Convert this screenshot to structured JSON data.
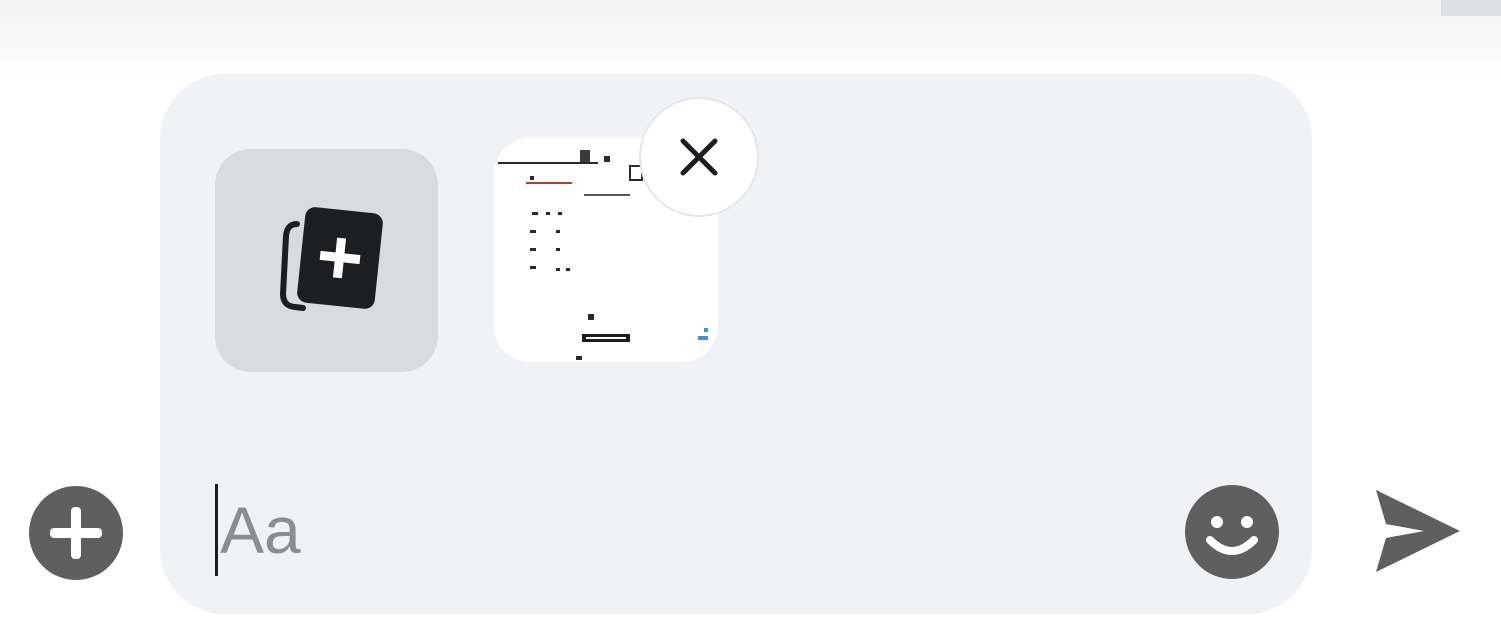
{
  "composer": {
    "placeholder": "Aa",
    "value": ""
  },
  "attachments": {
    "add_icon": "media-add-icon",
    "items": [
      {
        "type": "image",
        "icon": "image-thumbnail",
        "remove_icon": "close-icon"
      }
    ]
  },
  "actions": {
    "more_icon": "plus-circle-icon",
    "emoji_icon": "smiley-icon",
    "send_icon": "send-icon"
  },
  "colors": {
    "background": "#ffffff",
    "composer": "#f0f2f5",
    "tile": "#d8dbe0",
    "icon": "#5f5f5f",
    "text": "#1c1e21",
    "placeholder": "#8a8d91"
  }
}
